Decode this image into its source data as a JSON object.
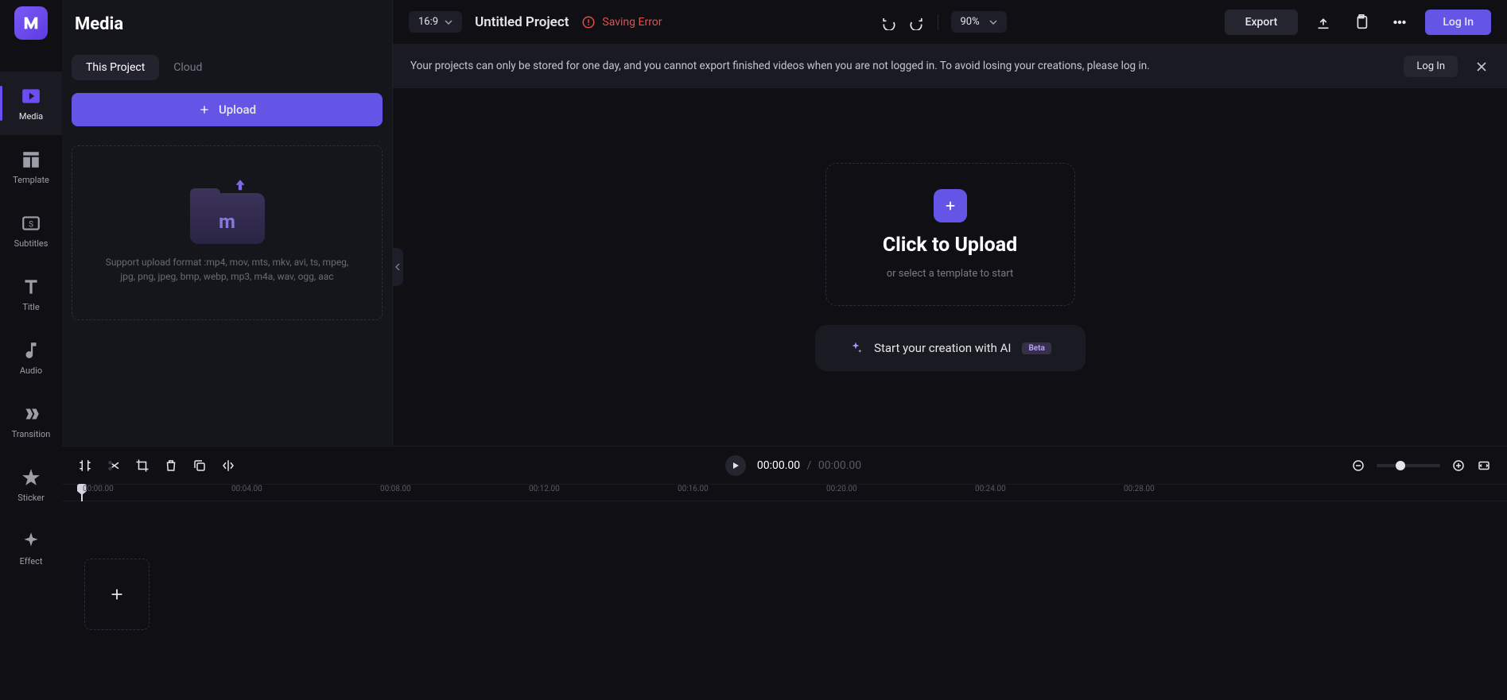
{
  "sidebar": {
    "items": [
      {
        "label": "Media"
      },
      {
        "label": "Template"
      },
      {
        "label": "Subtitles"
      },
      {
        "label": "Title"
      },
      {
        "label": "Audio"
      },
      {
        "label": "Transition"
      },
      {
        "label": "Sticker"
      },
      {
        "label": "Effect"
      }
    ]
  },
  "mediaPanel": {
    "title": "Media",
    "tabs": {
      "thisProject": "This Project",
      "cloud": "Cloud"
    },
    "uploadBtn": "Upload",
    "supportText": "Support upload format :mp4, mov, mts, mkv, avi, ts, mpeg, jpg, png, jpeg, bmp, webp, mp3, m4a, wav, ogg, aac"
  },
  "topBar": {
    "ratio": "16:9",
    "projectName": "Untitled Project",
    "savingStatus": "Saving Error",
    "zoom": "90%",
    "export": "Export",
    "login": "Log In"
  },
  "notice": {
    "text": "Your projects can only be stored for one day, and you cannot export finished videos when you are not logged in. To avoid losing your creations, please log in.",
    "login": "Log In"
  },
  "preview": {
    "uploadTitle": "Click to Upload",
    "uploadSub": "or select a template to start",
    "aiText": "Start your creation with AI",
    "beta": "Beta"
  },
  "timeline": {
    "currentTime": "00:00.00",
    "separator": "/",
    "totalTime": "00:00.00",
    "ticks": [
      "00:00.00",
      "00:04.00",
      "00:08.00",
      "00:12.00",
      "00:16.00",
      "00:20.00",
      "00:24.00",
      "00:28.00"
    ]
  }
}
